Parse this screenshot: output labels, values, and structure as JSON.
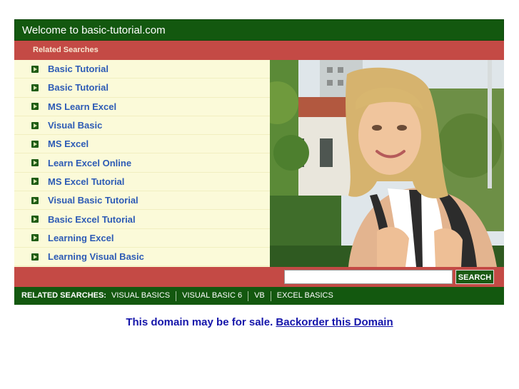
{
  "header": {
    "title": "Welcome to basic-tutorial.com"
  },
  "subheader": {
    "label": "Related Searches"
  },
  "related_links": [
    {
      "label": "Basic Tutorial"
    },
    {
      "label": "Basic Tutorial"
    },
    {
      "label": "MS Learn Excel"
    },
    {
      "label": "Visual Basic"
    },
    {
      "label": "MS Excel"
    },
    {
      "label": "Learn Excel Online"
    },
    {
      "label": "MS Excel Tutorial"
    },
    {
      "label": "Visual Basic Tutorial"
    },
    {
      "label": "Basic Excel Tutorial"
    },
    {
      "label": "Learning Excel"
    },
    {
      "label": "Learning Visual Basic"
    }
  ],
  "search": {
    "value": "",
    "button_label": "SEARCH"
  },
  "bottom_bar": {
    "label": "RELATED SEARCHES:",
    "links": [
      "VISUAL BASICS",
      "VISUAL BASIC 6",
      "VB",
      "EXCEL BASICS"
    ]
  },
  "sale": {
    "text": "This domain may be for sale.",
    "link_label": "Backorder this Domain"
  },
  "icons": {
    "bullet": "arrow-bullet-icon"
  },
  "colors": {
    "header_green": "#13580f",
    "bar_red": "#c44a45",
    "list_bg": "#fbfad9",
    "link_blue": "#2d5bb5",
    "sale_blue": "#1515aa"
  }
}
